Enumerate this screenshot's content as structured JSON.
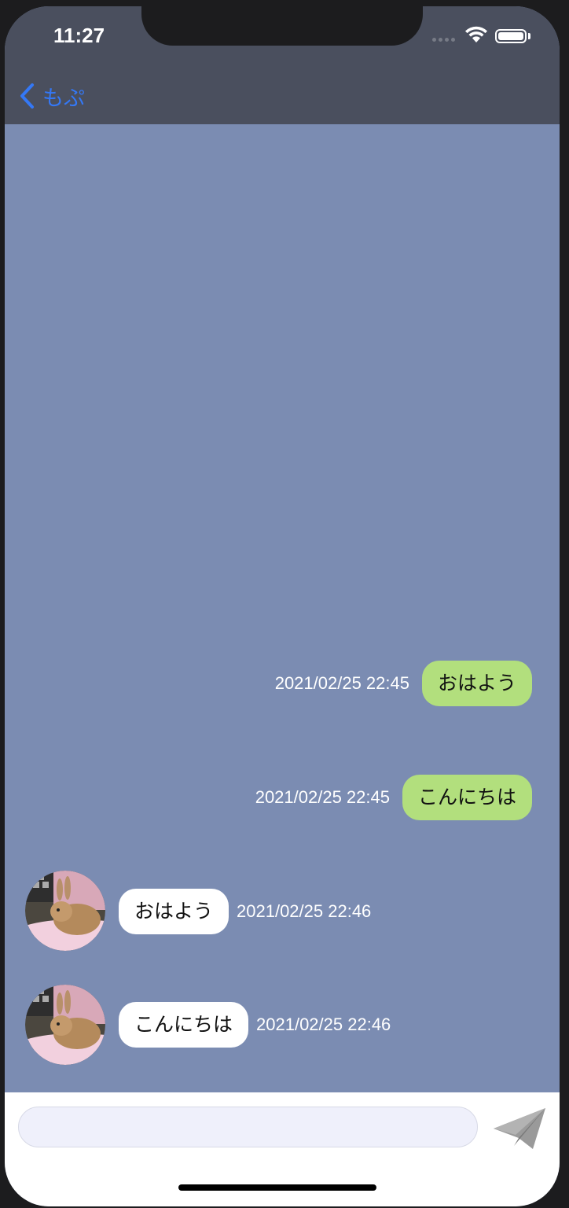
{
  "status_bar": {
    "time": "11:27"
  },
  "nav": {
    "back_label": "もぷ"
  },
  "messages": [
    {
      "direction": "outgoing",
      "text": "おはよう",
      "timestamp": "2021/02/25 22:45"
    },
    {
      "direction": "outgoing",
      "text": "こんにちは",
      "timestamp": "2021/02/25 22:45"
    },
    {
      "direction": "incoming",
      "text": "おはよう",
      "timestamp": "2021/02/25 22:46"
    },
    {
      "direction": "incoming",
      "text": "こんにちは",
      "timestamp": "2021/02/25 22:46"
    }
  ],
  "composer": {
    "value": "",
    "placeholder": ""
  },
  "colors": {
    "chat_background": "#7b8cb2",
    "nav_background": "#4a4f5e",
    "outgoing_bubble": "#b2df7d",
    "incoming_bubble": "#ffffff",
    "accent": "#3478f6"
  }
}
